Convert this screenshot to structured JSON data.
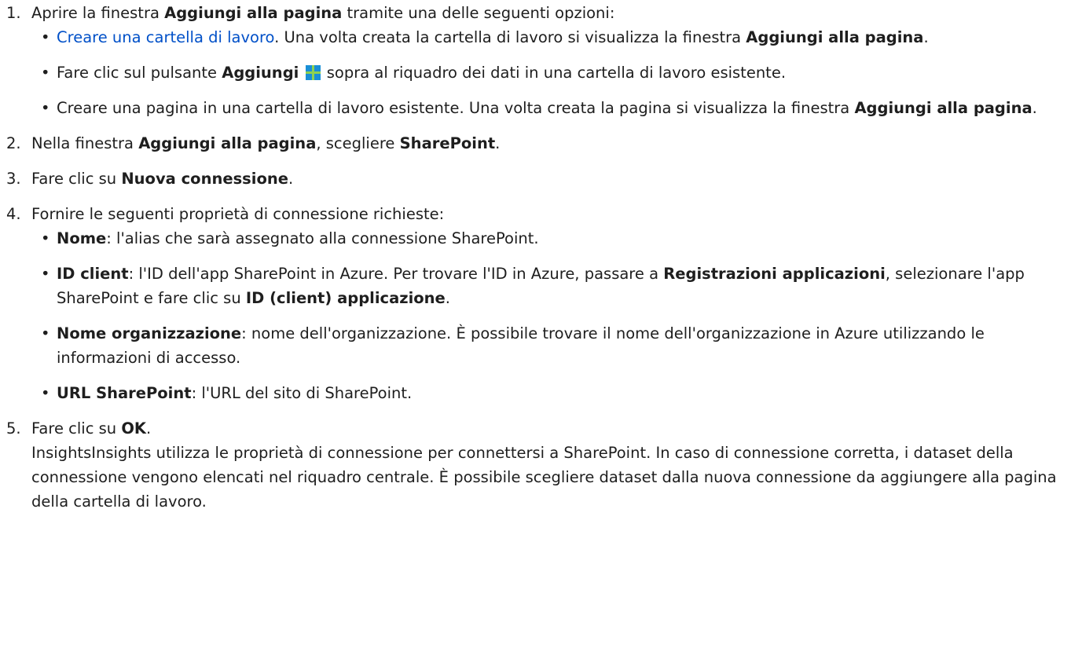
{
  "steps": [
    {
      "num": "1.",
      "pre": "Aprire la finestra ",
      "bold": "Aggiungi alla pagina",
      "post": " tramite una delle seguenti opzioni:",
      "items": [
        {
          "link": "Creare una cartella di lavoro",
          "text1": ". Una volta creata la cartella di lavoro si visualizza la finestra ",
          "bold1": "Aggiungi alla pagina",
          "text2": "."
        },
        {
          "text1": "Fare clic sul pulsante ",
          "bold1": "Aggiungi",
          "text2": " sopra al riquadro dei dati in una cartella di lavoro esistente."
        },
        {
          "text1": "Creare una pagina in una cartella di lavoro esistente. Una volta creata la pagina si visualizza la finestra ",
          "bold1": "Aggiungi alla pagina",
          "text2": "."
        }
      ]
    },
    {
      "num": "2.",
      "pre": "Nella finestra ",
      "bold": "Aggiungi alla pagina",
      "mid": ", scegliere ",
      "bold2": "SharePoint",
      "post": "."
    },
    {
      "num": "3.",
      "pre": "Fare clic su ",
      "bold": "Nuova connessione",
      "post": "."
    },
    {
      "num": "4.",
      "pre": "Fornire le seguenti proprietà di connessione richieste:",
      "items": [
        {
          "bold1": "Nome",
          "text1": ": l'alias che sarà assegnato alla connessione SharePoint."
        },
        {
          "bold1": "ID client",
          "text1": ": l'ID dell'app SharePoint in Azure. Per trovare l'ID in Azure, passare a ",
          "bold2": "Registrazioni applicazioni",
          "text2": ", selezionare l'app SharePoint e fare clic su ",
          "bold3": "ID (client) applicazione",
          "text3": "."
        },
        {
          "bold1": "Nome organizzazione",
          "text1": ": nome dell'organizzazione. È possibile trovare il nome dell'organizzazione in Azure utilizzando le informazioni di accesso."
        },
        {
          "bold1": "URL SharePoint",
          "text1": ": l'URL del sito di SharePoint."
        }
      ]
    },
    {
      "num": "5.",
      "pre": "Fare clic su ",
      "bold": "OK",
      "post": ".",
      "para": "InsightsInsights utilizza le proprietà di connessione per connettersi a SharePoint. In caso di connessione corretta, i dataset della connessione vengono elencati nel riquadro centrale. È possibile scegliere dataset dalla nuova connessione da aggiungere alla pagina della cartella di lavoro."
    }
  ],
  "bullet": "•",
  "icons": {
    "add": "plus-icon",
    "add_color": "#1a8fd6"
  }
}
